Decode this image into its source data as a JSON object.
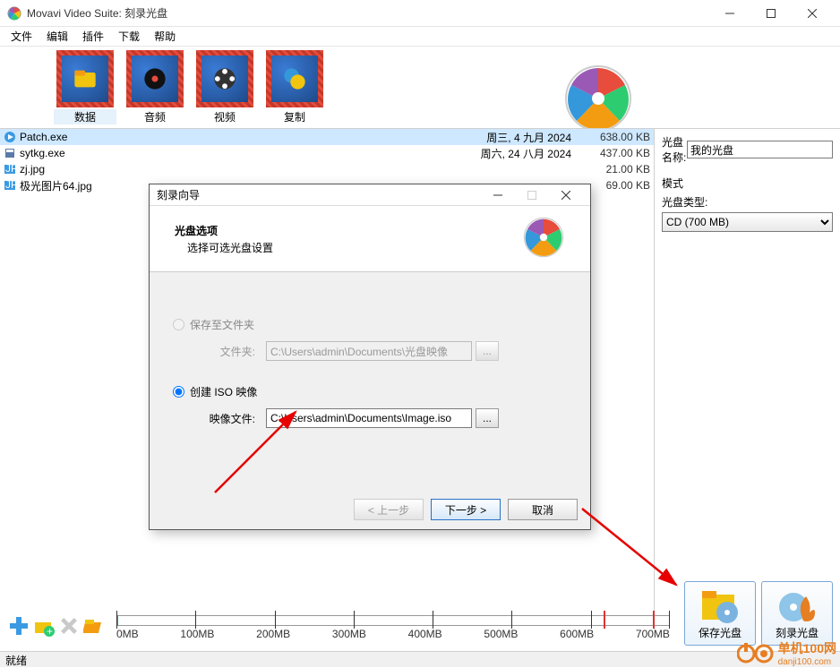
{
  "window": {
    "title": "Movavi Video Suite: 刻录光盘"
  },
  "menus": [
    "文件",
    "编辑",
    "插件",
    "下载",
    "帮助"
  ],
  "categories": [
    {
      "label": "数据",
      "icon": "folder"
    },
    {
      "label": "音频",
      "icon": "disc"
    },
    {
      "label": "视频",
      "icon": "reel"
    },
    {
      "label": "复制",
      "icon": "copy"
    }
  ],
  "files": [
    {
      "name": "Patch.exe",
      "date": "周三, 4 九月 2024",
      "size": "638.00 KB",
      "type": "exe",
      "selected": true
    },
    {
      "name": "sytkg.exe",
      "date": "周六, 24 八月 2024",
      "size": "437.00 KB",
      "type": "exe"
    },
    {
      "name": "zj.jpg",
      "date": "",
      "size": "21.00 KB",
      "type": "jpg"
    },
    {
      "name": "极光图片64.jpg",
      "date": "",
      "size": "69.00 KB",
      "type": "jpg"
    }
  ],
  "right_panel": {
    "disc_name_label": "光盘名称:",
    "disc_name_value": "我的光盘",
    "mode_label": "模式",
    "disc_type_label": "光盘类型:",
    "disc_type_value": "CD (700 MB)"
  },
  "scale_labels": [
    "0MB",
    "100MB",
    "200MB",
    "300MB",
    "400MB",
    "500MB",
    "600MB",
    "700MB"
  ],
  "big_buttons": {
    "save": "保存光盘",
    "burn": "刻录光盘"
  },
  "status": "就绪",
  "dialog": {
    "title": "刻录向导",
    "header_title": "光盘选项",
    "header_subtitle": "选择可选光盘设置",
    "radio_folder": "保存至文件夹",
    "folder_label": "文件夹:",
    "folder_value": "C:\\Users\\admin\\Documents\\光盘映像",
    "radio_iso": "创建 ISO 映像",
    "image_label": "映像文件:",
    "image_value": "C:\\Users\\admin\\Documents\\Image.iso",
    "browse": "...",
    "back": "< 上一步",
    "next": "下一步 >",
    "cancel": "取消"
  },
  "watermark": {
    "name": "单机100网",
    "url": "danji100.com"
  }
}
